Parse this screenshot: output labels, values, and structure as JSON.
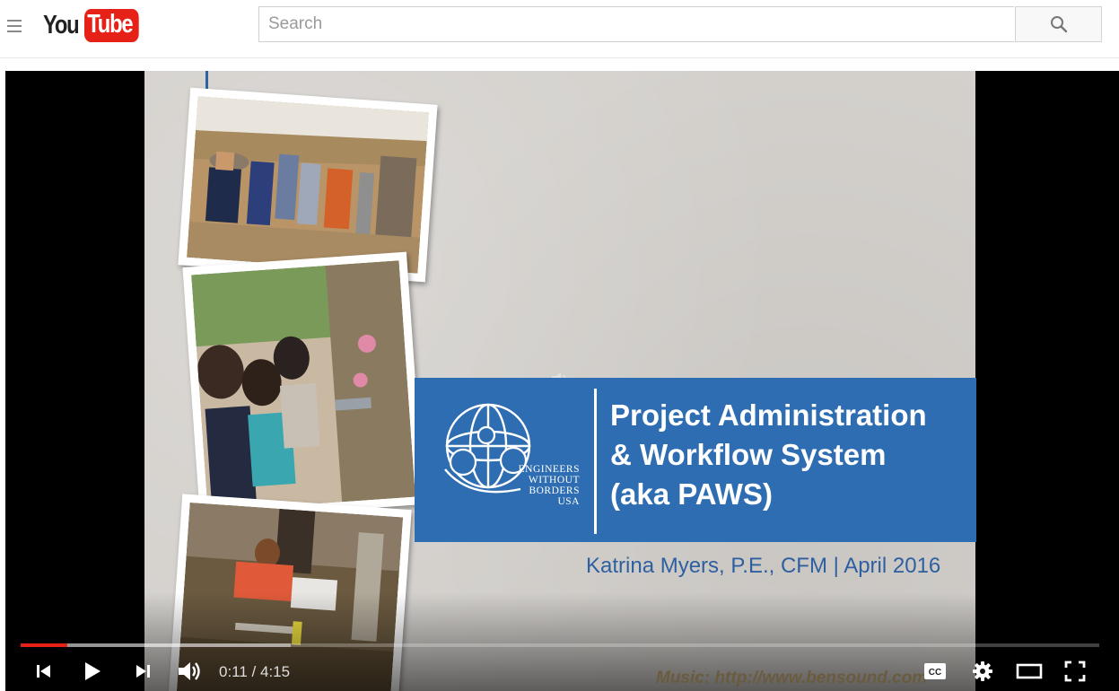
{
  "masthead": {
    "logo_you": "You",
    "logo_tube": "Tube",
    "search_placeholder": "Search",
    "search_value": ""
  },
  "slide": {
    "title_lines": [
      "Project Administration",
      "& Workflow System",
      "(aka PAWS)"
    ],
    "org_lines": [
      "ENGINEERS",
      "WITHOUT",
      "BORDERS",
      "USA"
    ],
    "byline": "Katrina Myers, P.E., CFM | April 2016",
    "music_credit": "Music: http://www.bensound.com"
  },
  "player": {
    "time_display": "0:11 / 4:15",
    "played_fraction": 0.043,
    "loaded_fraction": 0.25
  },
  "icons": [
    "menu-icon",
    "search-icon",
    "skip-back-icon",
    "play-icon",
    "skip-next-icon",
    "volume-icon",
    "cc-icon",
    "gear-icon",
    "theater-mode-icon",
    "fullscreen-icon"
  ],
  "colors": {
    "brand_red": "#e62117",
    "slide_blue": "#2e6db1",
    "byline_blue": "#2e5fa0"
  }
}
